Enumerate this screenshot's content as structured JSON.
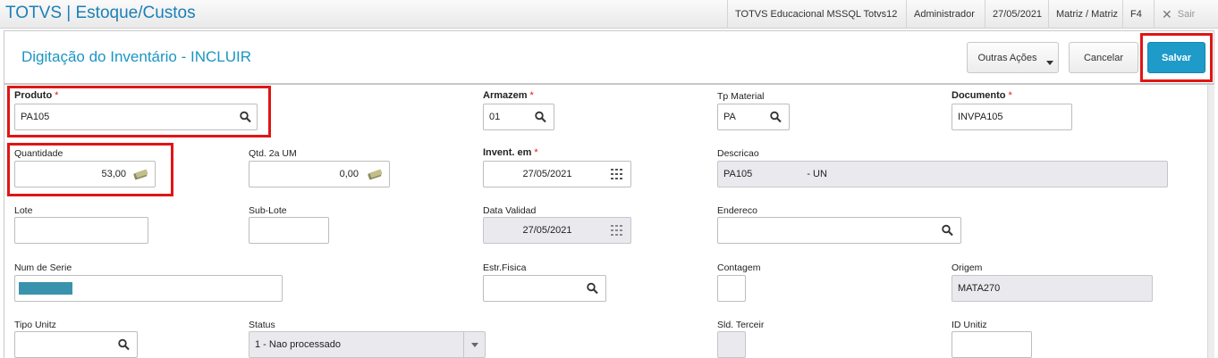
{
  "header": {
    "app_title": "TOTVS | Estoque/Custos",
    "environment": "TOTVS Educacional MSSQL Totvs12",
    "user": "Administrador",
    "date": "27/05/2021",
    "branch": "Matriz / Matriz",
    "shortcut": "F4",
    "exit_label": "Sair"
  },
  "page": {
    "title": "Digitação do Inventário - INCLUIR",
    "other_actions_label": "Outras Ações",
    "cancel_label": "Cancelar",
    "save_label": "Salvar"
  },
  "form": {
    "produto": {
      "label": "Produto",
      "value": "PA105"
    },
    "armazem": {
      "label": "Armazem",
      "value": "01"
    },
    "tp_material": {
      "label": "Tp Material",
      "value": "PA"
    },
    "documento": {
      "label": "Documento",
      "value": "INVPA105"
    },
    "quantidade": {
      "label": "Quantidade",
      "value": "53,00"
    },
    "qtd_2a_um": {
      "label": "Qtd. 2a UM",
      "value": "0,00"
    },
    "invent_em": {
      "label": "Invent. em",
      "value": "27/05/2021"
    },
    "descricao": {
      "label": "Descricao",
      "value": "PA105                    - UN"
    },
    "lote": {
      "label": "Lote",
      "value": ""
    },
    "sub_lote": {
      "label": "Sub-Lote",
      "value": ""
    },
    "data_validad": {
      "label": "Data Validad",
      "value": "27/05/2021"
    },
    "endereco": {
      "label": "Endereco",
      "value": ""
    },
    "num_serie": {
      "label": "Num de Serie",
      "value": ""
    },
    "estr_fisica": {
      "label": "Estr.Fisica",
      "value": ""
    },
    "contagem": {
      "label": "Contagem",
      "value": ""
    },
    "origem": {
      "label": "Origem",
      "value": "MATA270"
    },
    "tipo_unitz": {
      "label": "Tipo Unitz",
      "value": ""
    },
    "status": {
      "label": "Status",
      "value": "1 - Nao processado"
    },
    "sld_terceir": {
      "label": "Sld. Terceir",
      "value": ""
    },
    "id_unitiz": {
      "label": "ID Unitiz",
      "value": ""
    },
    "required_mark": "*"
  },
  "colors": {
    "brand": "#1b7fb8",
    "primary_button": "#1e9bc9",
    "highlight": "#e01515"
  }
}
